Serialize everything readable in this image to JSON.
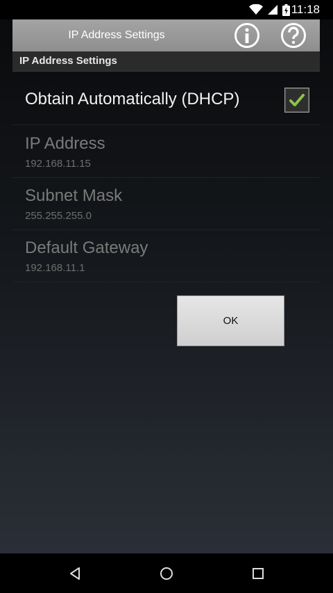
{
  "status_bar": {
    "time": "11:18",
    "icons": [
      "wifi-icon",
      "signal-icon",
      "battery-icon"
    ]
  },
  "title_bar": {
    "title": "IP Address Settings",
    "info_icon": "info-icon",
    "help_icon": "help-icon"
  },
  "section": {
    "header": "IP Address Settings"
  },
  "dhcp": {
    "label": "Obtain Automatically (DHCP)",
    "checked": true,
    "check_color": "#8bc34a"
  },
  "fields": [
    {
      "title": "IP Address",
      "value": "192.168.11.15"
    },
    {
      "title": "Subnet Mask",
      "value": "255.255.255.0"
    },
    {
      "title": "Default Gateway",
      "value": "192.168.11.1"
    }
  ],
  "ok_button": {
    "label": "OK"
  },
  "nav_bar": {
    "buttons": [
      "back-icon",
      "home-icon",
      "recents-icon"
    ]
  }
}
